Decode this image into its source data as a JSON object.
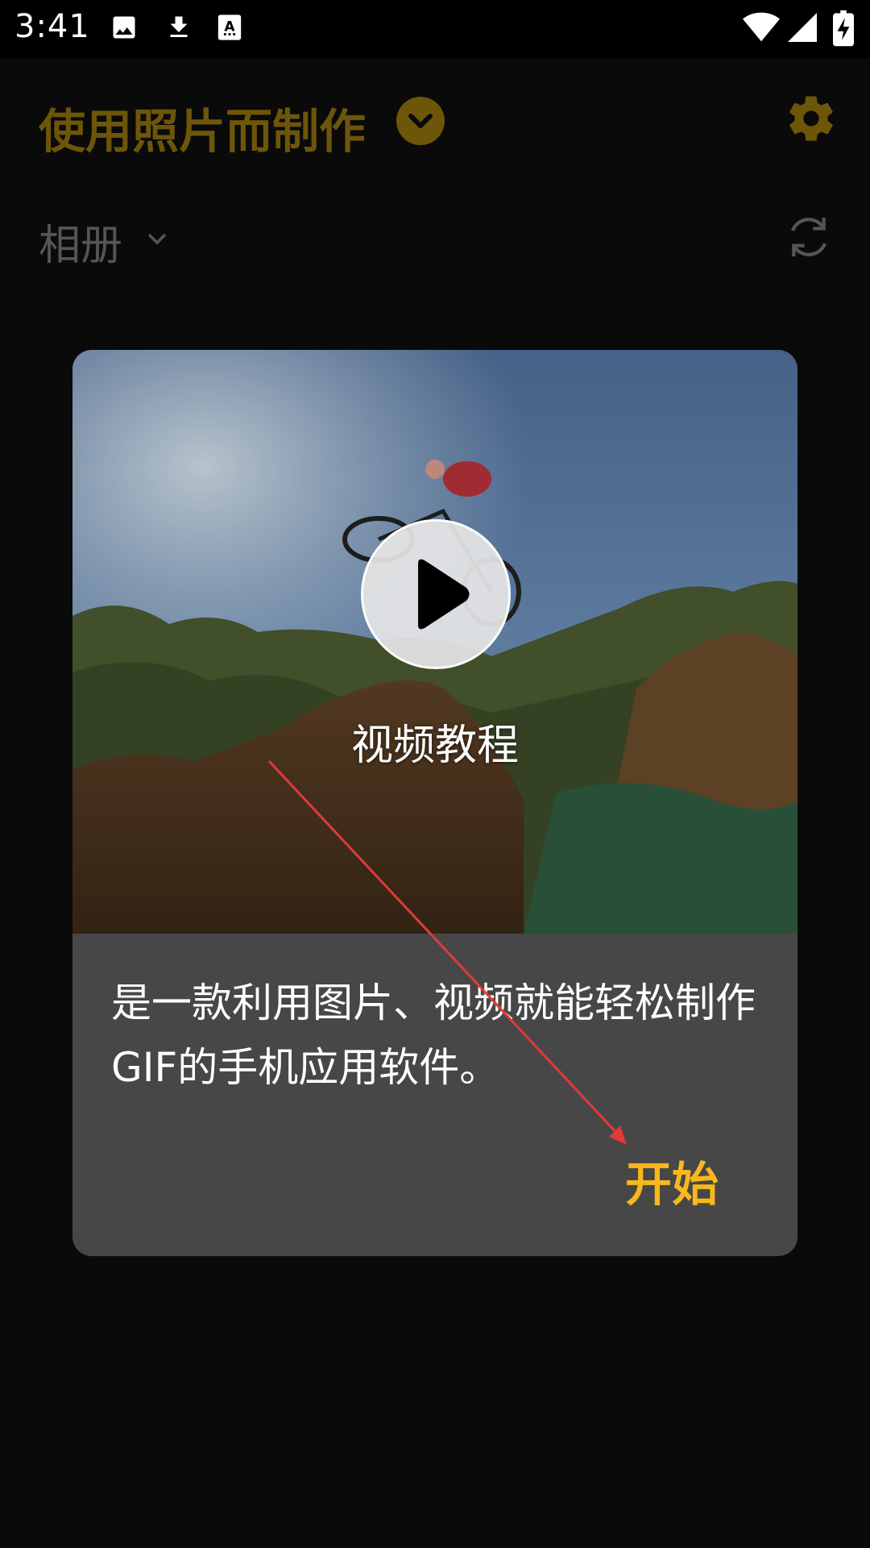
{
  "status_bar": {
    "time": "3:41",
    "left_icons": [
      "image-icon",
      "download-icon",
      "text-icon"
    ],
    "right_icons": [
      "wifi-icon",
      "signal-icon",
      "battery-charging-icon"
    ]
  },
  "header": {
    "title": "使用照片而制作",
    "dropdown_icon": "chevron-down-circle-icon",
    "settings_icon": "gear-icon",
    "accent_color": "#6e5608"
  },
  "album_bar": {
    "label": "相册",
    "chevron_icon": "chevron-down-icon",
    "refresh_icon": "refresh-icon"
  },
  "dialog": {
    "video_caption": "视频教程",
    "play_icon": "play-icon",
    "description": "是一款利用图片、视频就能轻松制作GIF的手机应用软件。",
    "start_label": "开始",
    "start_color": "#f8b81c"
  }
}
